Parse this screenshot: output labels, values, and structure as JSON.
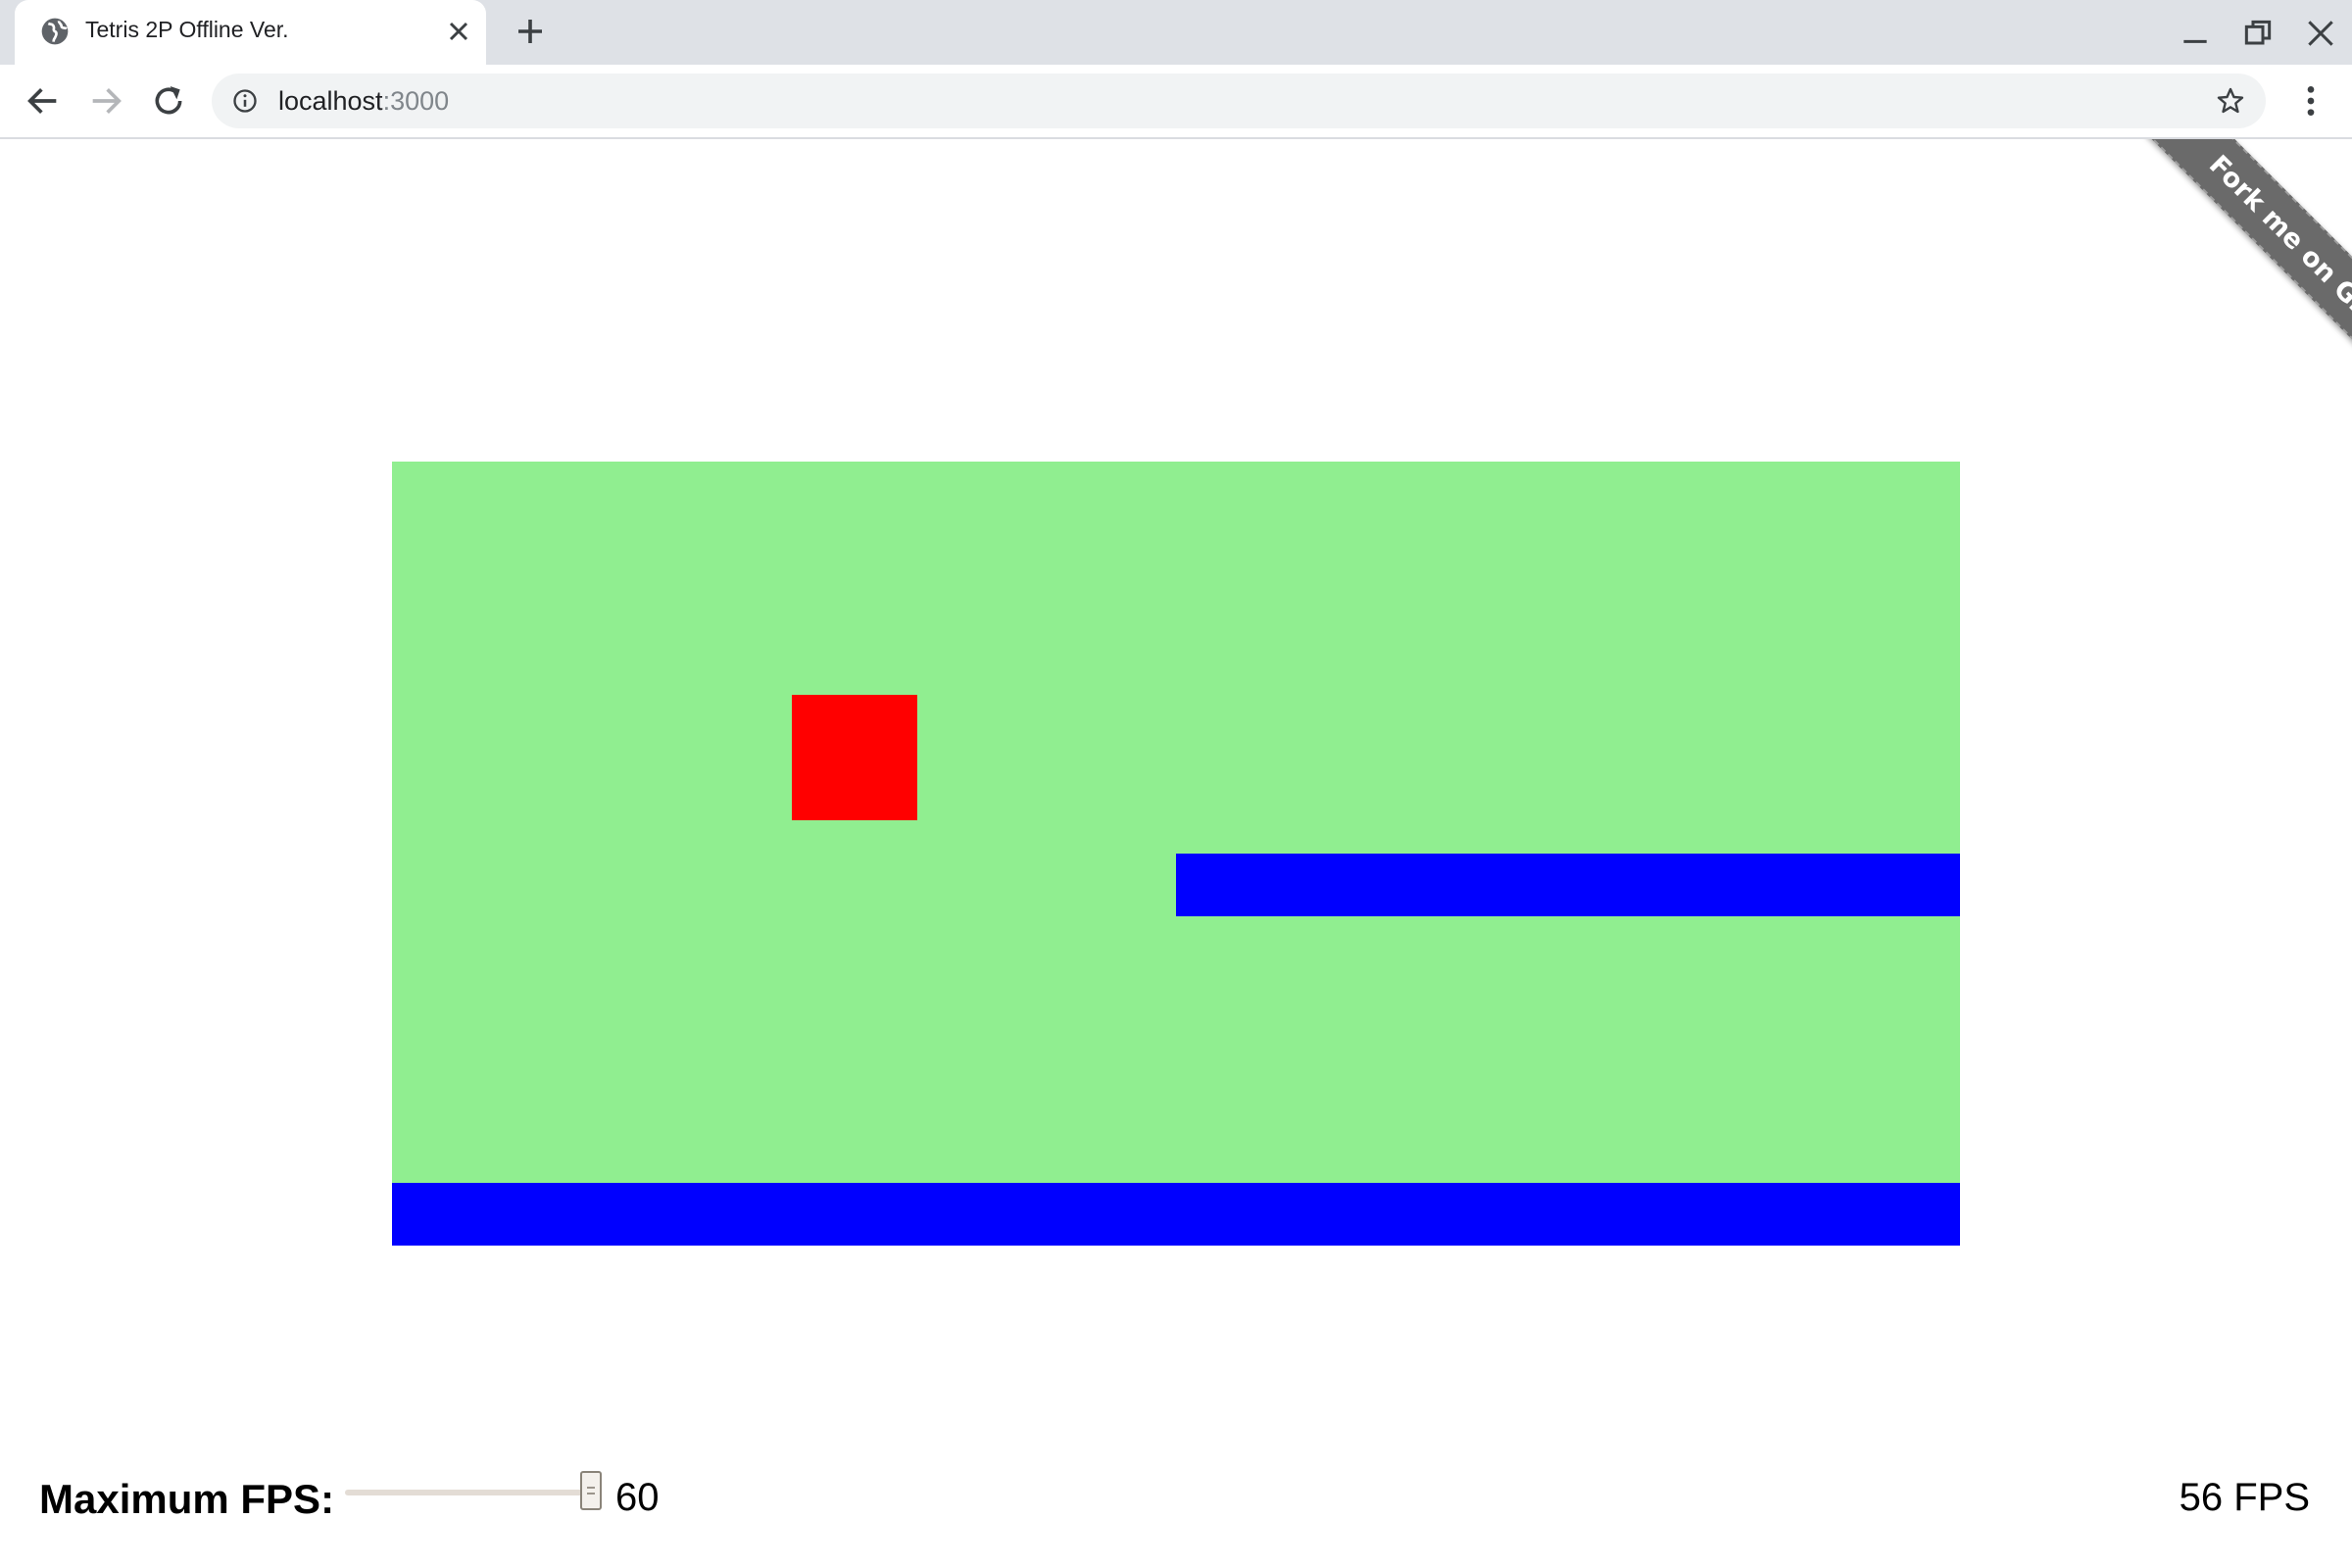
{
  "browser": {
    "tab_title": "Tetris 2P Offline Ver.",
    "favicon": "globe-icon",
    "url_host": "localhost",
    "url_port": ":3000"
  },
  "page": {
    "ribbon_text": "Fork me on GitHub",
    "game_board": {
      "background_color": "#90ee90",
      "blocks": [
        {
          "name": "red-square",
          "color": "#ff0000"
        },
        {
          "name": "blue-bar-middle",
          "color": "#0000ff"
        },
        {
          "name": "blue-bar-bottom",
          "color": "#0000ff"
        }
      ]
    },
    "fps_control": {
      "label": "Maximum FPS:",
      "slider_value": "60",
      "slider_fraction": 1.0
    },
    "fps_readout": "56 FPS"
  }
}
